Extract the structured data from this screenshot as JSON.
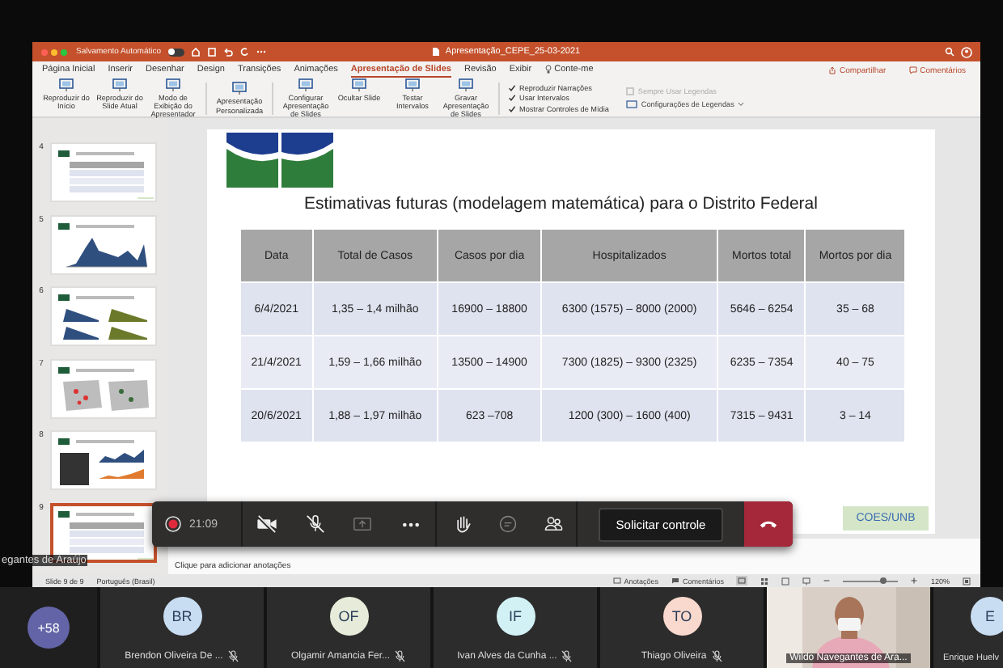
{
  "app_window": {
    "title": "Apresentação_CEPE_25-03-2021",
    "autosave": {
      "label": "Salvamento Automático",
      "on": false
    }
  },
  "ribbon_tabs": [
    {
      "label": "Página Inicial",
      "selected": false,
      "kind": "tab"
    },
    {
      "label": "Inserir",
      "selected": false,
      "kind": "tab"
    },
    {
      "label": "Desenhar",
      "selected": false,
      "kind": "tab"
    },
    {
      "label": "Design",
      "selected": false,
      "kind": "tab"
    },
    {
      "label": "Transições",
      "selected": false,
      "kind": "tab"
    },
    {
      "label": "Animações",
      "selected": false,
      "kind": "tab"
    },
    {
      "label": "Apresentação de Slides",
      "selected": true,
      "kind": "tab"
    },
    {
      "label": "Revisão",
      "selected": false,
      "kind": "tab"
    },
    {
      "label": "Exibir",
      "selected": false,
      "kind": "tab"
    },
    {
      "label": "Conte-me",
      "selected": false,
      "kind": "tell-me"
    }
  ],
  "share_button": "Compartilhar",
  "comments_button": "Comentários",
  "ribbon": {
    "button_groups": [
      [
        "Reproduzir do Início",
        "Reproduzir do Slide Atual",
        "Modo de Exibição do Apresentador"
      ],
      [
        "Apresentação Personalizada"
      ],
      [
        "Configurar Apresentação de Slides",
        "Ocultar Slide",
        "Testar Intervalos",
        "Gravar Apresentação de Slides"
      ]
    ],
    "options": [
      {
        "label": "Reproduzir Narrações",
        "checked": true
      },
      {
        "label": "Usar Intervalos",
        "checked": true
      },
      {
        "label": "Mostrar Controles de Mídia",
        "checked": true
      }
    ],
    "captions": {
      "label": "Sempre Usar Legendas",
      "checked": false,
      "disabled": true
    },
    "caption_settings": "Configurações de Legendas"
  },
  "thumbnails": [
    {
      "number": "4",
      "kind": "table",
      "selected": false
    },
    {
      "number": "5",
      "kind": "area-chart",
      "selected": false
    },
    {
      "number": "6",
      "kind": "area-charts",
      "selected": false
    },
    {
      "number": "7",
      "kind": "maps",
      "selected": false
    },
    {
      "number": "8",
      "kind": "mixed",
      "selected": false
    },
    {
      "number": "9",
      "kind": "table",
      "selected": true
    }
  ],
  "slide": {
    "title": "Estimativas futuras (modelagem matemática) para o Distrito Federal",
    "table": {
      "columns": [
        "Data",
        "Total de Casos",
        "Casos por dia",
        "Hospitalizados",
        "Mortos total",
        "Mortos por dia"
      ],
      "rows": [
        [
          "6/4/2021",
          "1,35 – 1,4 milhão",
          "16900 – 18800",
          "6300 (1575) – 8000 (2000)",
          "5646 – 6254",
          "35 – 68"
        ],
        [
          "21/4/2021",
          "1,59 – 1,66 milhão",
          "13500 – 14900",
          "7300 (1825) – 9300 (2325)",
          "6235 – 7354",
          "40 – 75"
        ],
        [
          "20/6/2021",
          "1,88 – 1,97 milhão",
          "623 –708",
          "1200 (300) – 1600 (400)",
          "7315 – 9431",
          "3 – 14"
        ]
      ]
    },
    "footer_tag": "COES/UNB"
  },
  "notes_placeholder": "Clique para adicionar anotações",
  "status_bar": {
    "slide_position": "Slide 9 de 9",
    "language": "Português (Brasil)",
    "notes": "Anotações",
    "comments": "Comentários",
    "zoom_slider": {
      "level": 0.72
    },
    "zoom": "120%"
  },
  "meeting_controls": {
    "recording": true,
    "timer": "21:09",
    "camera_on": false,
    "mic_on": false,
    "share_enabled": false,
    "request_control": "Solicitar controle"
  },
  "presenter_name": "egantes de Araújo",
  "participants": {
    "overflow": "+58",
    "tiles": [
      {
        "kind": "avatar",
        "initials": "BR",
        "name": "Brendon Oliveira De ...",
        "color": "#c9ddf2",
        "muted": true
      },
      {
        "kind": "avatar",
        "initials": "OF",
        "name": "Olgamir Amancia Fer...",
        "color": "#e6ecd9",
        "muted": true
      },
      {
        "kind": "avatar",
        "initials": "IF",
        "name": "Ivan Alves da Cunha ...",
        "color": "#d2f1f5",
        "muted": true
      },
      {
        "kind": "avatar",
        "initials": "TO",
        "name": "Thiago Oliveira",
        "color": "#f9d9cd",
        "muted": true
      },
      {
        "kind": "video",
        "name": "Wildo Navegantes de Ara...",
        "muted": false
      },
      {
        "kind": "edge",
        "initials": "E",
        "name": "Enrique Huelv",
        "color": "#c9ddf2",
        "muted": false
      }
    ]
  }
}
